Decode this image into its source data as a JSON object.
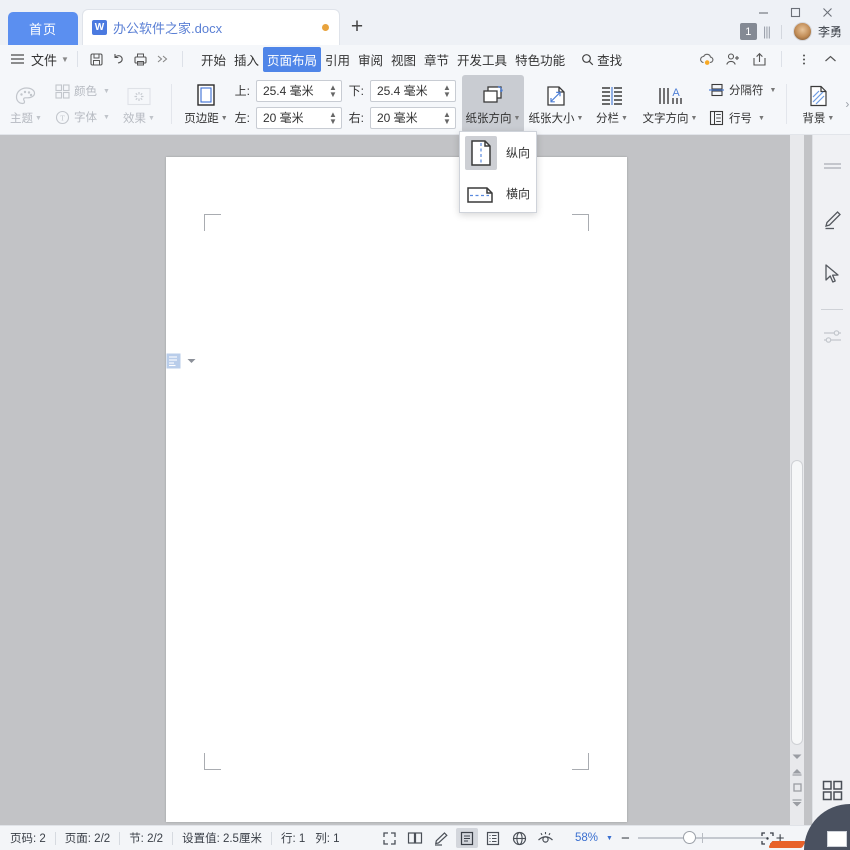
{
  "titlebar": {
    "home_tab": "首页",
    "doc_tab": {
      "name": "办公软件之家.docx",
      "app_badge": "W",
      "modified_dot": "unsaved-dot"
    },
    "new_tab": "+",
    "window": {
      "minimize": "—",
      "maximize": "□",
      "close": "✕"
    },
    "page_badge": "1",
    "account_name": "李勇"
  },
  "menubar": {
    "file": "文件",
    "quick_access": [
      "save-icon",
      "undo-icon",
      "print-icon",
      "more-chevrons-icon"
    ],
    "items": [
      {
        "label": "开始",
        "active": false
      },
      {
        "label": "插入",
        "active": false
      },
      {
        "label": "页面布局",
        "active": true
      },
      {
        "label": "引用",
        "active": false
      },
      {
        "label": "审阅",
        "active": false
      },
      {
        "label": "视图",
        "active": false
      },
      {
        "label": "章节",
        "active": false
      },
      {
        "label": "开发工具",
        "active": false
      },
      {
        "label": "特色功能",
        "active": false
      }
    ],
    "find": "查找",
    "right_icons": [
      "cloud-sync-icon",
      "add-user-icon",
      "share-icon",
      "more-vertical-icon",
      "collapse-ribbon-icon"
    ]
  },
  "ribbon": {
    "theme": {
      "label": "主题",
      "disabled": true
    },
    "color": {
      "label": "颜色",
      "disabled": true
    },
    "font": {
      "label": "字体",
      "disabled": true
    },
    "effect": {
      "label": "效果",
      "disabled": true
    },
    "page_margin": {
      "label": "页边距"
    },
    "margins": {
      "top": {
        "label": "上:",
        "value": "25.4 毫米"
      },
      "bottom": {
        "label": "下:",
        "value": "25.4 毫米"
      },
      "left": {
        "label": "左:",
        "value": "20 毫米"
      },
      "right": {
        "label": "右:",
        "value": "20 毫米"
      }
    },
    "paper_orientation": {
      "label": "纸张方向",
      "expanded": true
    },
    "paper_size": {
      "label": "纸张大小"
    },
    "columns": {
      "label": "分栏"
    },
    "text_direction": {
      "label": "文字方向"
    },
    "separator": {
      "label": "分隔符"
    },
    "line_number": {
      "label": "行号"
    },
    "background": {
      "label": "背景"
    },
    "overflow": "›"
  },
  "orientation_menu": {
    "items": [
      {
        "label": "纵向",
        "icon": "portrait-page-icon",
        "selected": true
      },
      {
        "label": "横向",
        "icon": "landscape-page-icon",
        "selected": false
      }
    ]
  },
  "document": {
    "paste_options": "paste-options-icon",
    "margin_marks": "corner-margin-marks"
  },
  "right_sidebar": {
    "items": [
      {
        "icon": "menu-lines-icon"
      },
      {
        "icon": "pen-highlighter-icon"
      },
      {
        "icon": "cursor-select-icon"
      },
      {
        "icon": "sliders-settings-icon"
      }
    ],
    "bottom": {
      "icon": "grid-apps-icon"
    }
  },
  "statusbar": {
    "page_number": "页码: 2",
    "page_count": "页面: 2/2",
    "section": "节: 2/2",
    "setting_value": "设置值: 2.5厘米",
    "row": "行: 1",
    "column": "列: 1",
    "view_icons": [
      {
        "icon": "fullscreen-view-icon",
        "active": false
      },
      {
        "icon": "book-view-icon",
        "active": false
      },
      {
        "icon": "edit-pen-icon",
        "active": false
      },
      {
        "icon": "page-view-icon",
        "active": true
      },
      {
        "icon": "outline-view-icon",
        "active": false
      },
      {
        "icon": "web-view-icon",
        "active": false
      },
      {
        "icon": "eye-protect-icon",
        "active": false
      }
    ],
    "zoom_value": "58%",
    "zoom_minus": "−",
    "zoom_plus": "+",
    "fullscreen": "fullscreen-toggle-icon"
  },
  "colors": {
    "accent_blue": "#4f85e8",
    "tab_blue": "#5b8ff0",
    "doc_text_blue": "#5a7fd4",
    "modified_orange": "#e8a33d",
    "page_bg": "#c2c3c6",
    "chrome_bg": "#f5f7fa"
  }
}
